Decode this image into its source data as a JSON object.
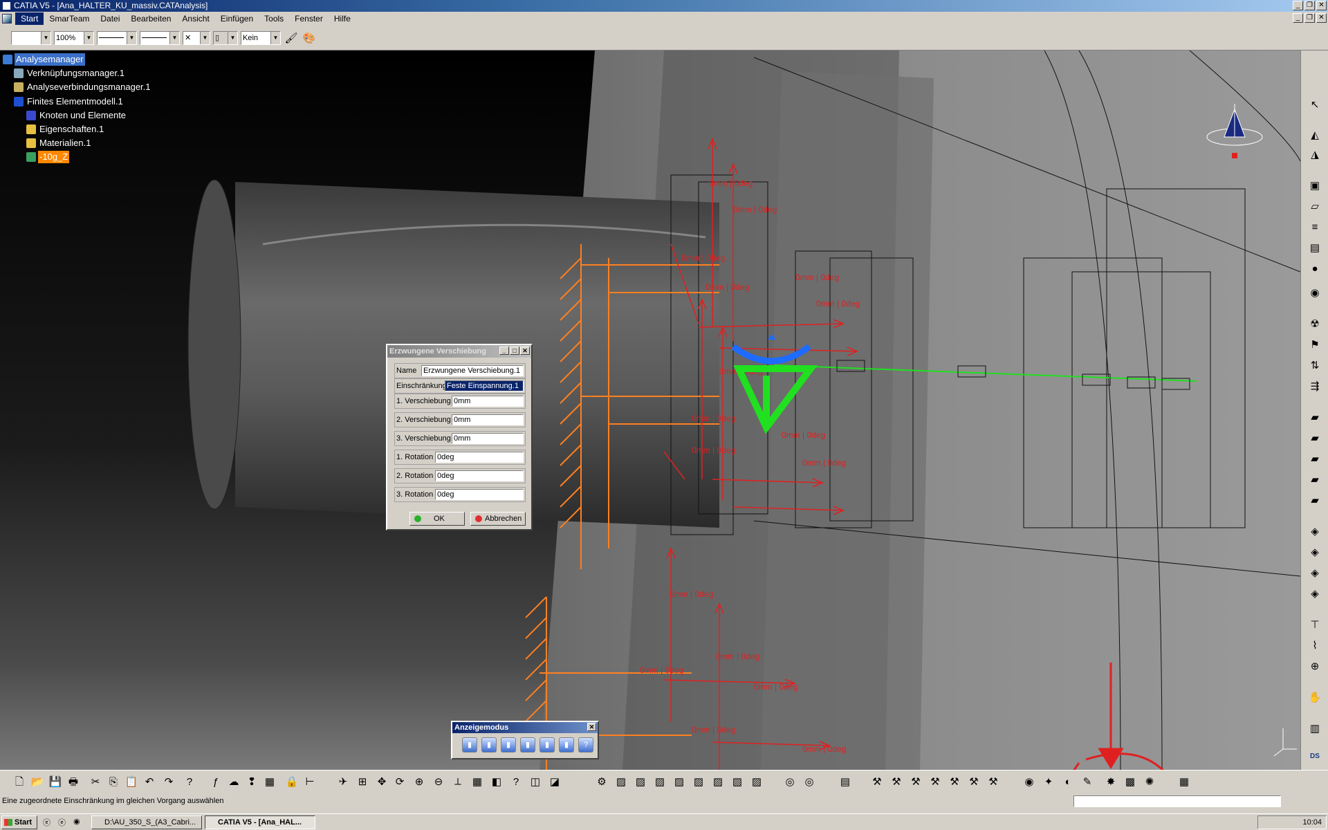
{
  "window": {
    "title": "CATIA V5 - [Ana_HALTER_KU_massiv.CATAnalysis]"
  },
  "menu": {
    "items": [
      "Start",
      "SmarTeam",
      "Datei",
      "Bearbeiten",
      "Ansicht",
      "Einfügen",
      "Tools",
      "Fenster",
      "Hilfe"
    ]
  },
  "toolbar": {
    "zoom": "100%",
    "layer": "Kein"
  },
  "tree": {
    "items": [
      {
        "label": "Analysemanager",
        "state": "selected"
      },
      {
        "label": "Verknüpfungsmanager.1"
      },
      {
        "label": "Analyseverbindungsmanager.1"
      },
      {
        "label": "Finites Elementmodell.1"
      },
      {
        "label": "Knoten und Elemente"
      },
      {
        "label": "Eigenschaften.1"
      },
      {
        "label": "Materialien.1"
      },
      {
        "label": "-10g_Z",
        "state": "highlighted"
      }
    ]
  },
  "dialog": {
    "title": "Erzwungene Verschiebung",
    "name_label": "Name",
    "name_value": "Erzwungene Verschiebung.1",
    "constraint_label": "Einschränkung",
    "constraint_value": "Feste Einspannung.1",
    "fields": [
      {
        "label": "1. Verschiebung",
        "value": "0mm"
      },
      {
        "label": "2. Verschiebung",
        "value": "0mm"
      },
      {
        "label": "3. Verschiebung",
        "value": "0mm"
      },
      {
        "label": "1. Rotation",
        "value": "0deg"
      },
      {
        "label": "2. Rotation",
        "value": "0deg"
      },
      {
        "label": "3. Rotation",
        "value": "0deg"
      }
    ],
    "ok_label": "OK",
    "cancel_label": "Abbrechen"
  },
  "display_mode": {
    "title": "Anzeigemodus"
  },
  "scene": {
    "annotation_text": "0mm | 0deg"
  },
  "status": {
    "message": "Eine zugeordnete Einschränkung im gleichen Vorgang auswählen"
  },
  "taskbar": {
    "start_label": "Start",
    "tasks": [
      "D:\\AU_350_S_(A3_Cabri...",
      "CATIA V5 - [Ana_HAL..."
    ],
    "clock": "10:04"
  },
  "colors": {
    "constraint_red": "#e02020",
    "clamp_orange": "#ff8020",
    "spec_green": "#20e020",
    "spec_blue": "#1e6bff"
  }
}
